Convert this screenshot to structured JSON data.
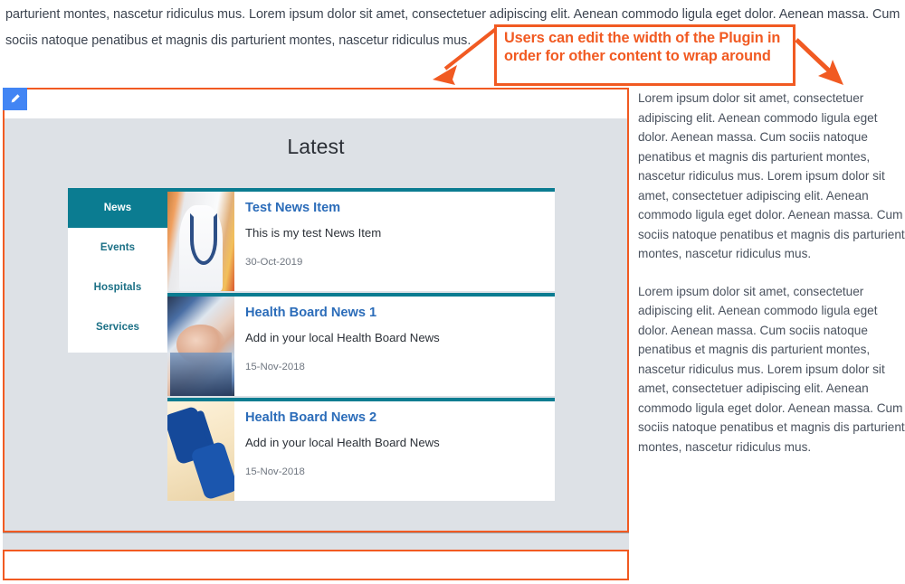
{
  "article": {
    "line1": "parturient montes, nascetur ridiculus mus. Lorem ipsum dolor sit amet, consectetuer adipiscing elit. Aenean commodo ligula eget dolor. Aenean massa. Cum",
    "line2": "sociis natoque penatibus et magnis dis parturient montes, nascetur ridiculus mus."
  },
  "callout": {
    "text": "Users can edit the width of the Plugin in order for other content to wrap around",
    "color": "#f15a22"
  },
  "plugin": {
    "edit_icon": "pencil-icon",
    "edit_badge_color": "#4285f4",
    "border_color": "#f15a22",
    "background": "#dde1e6",
    "widget_title": "Latest",
    "accent_color": "#0b7c91",
    "tabs": [
      {
        "label": "News",
        "active": true
      },
      {
        "label": "Events",
        "active": false
      },
      {
        "label": "Hospitals",
        "active": false
      },
      {
        "label": "Services",
        "active": false
      }
    ],
    "items": [
      {
        "title": "Test News Item",
        "description": "This is my test News Item",
        "date": "30-Oct-2019",
        "thumb": "doctor-photo"
      },
      {
        "title": "Health Board News 1",
        "description": "Add in your local Health Board News",
        "date": "15-Nov-2018",
        "thumb": "hands-photo"
      },
      {
        "title": "Health Board News 2",
        "description": "Add in your local Health Board News",
        "date": "15-Nov-2018",
        "thumb": "puzzle-photo"
      }
    ]
  },
  "right_column": {
    "paragraph1": "Lorem ipsum dolor sit amet, consectetuer adipiscing elit. Aenean commodo ligula eget dolor. Aenean massa. Cum sociis natoque penatibus et magnis dis parturient montes, nascetur ridiculus mus. Lorem ipsum dolor sit amet, consectetuer adipiscing elit. Aenean commodo ligula eget dolor. Aenean massa. Cum sociis natoque penatibus et magnis dis parturient montes, nascetur ridiculus mus.",
    "paragraph2": "Lorem ipsum dolor sit amet, consectetuer adipiscing elit. Aenean commodo ligula eget dolor. Aenean massa. Cum sociis natoque penatibus et magnis dis parturient montes, nascetur ridiculus mus. Lorem ipsum dolor sit amet, consectetuer adipiscing elit. Aenean commodo ligula eget dolor. Aenean massa. Cum sociis natoque penatibus et magnis dis parturient montes, nascetur ridiculus mus."
  }
}
